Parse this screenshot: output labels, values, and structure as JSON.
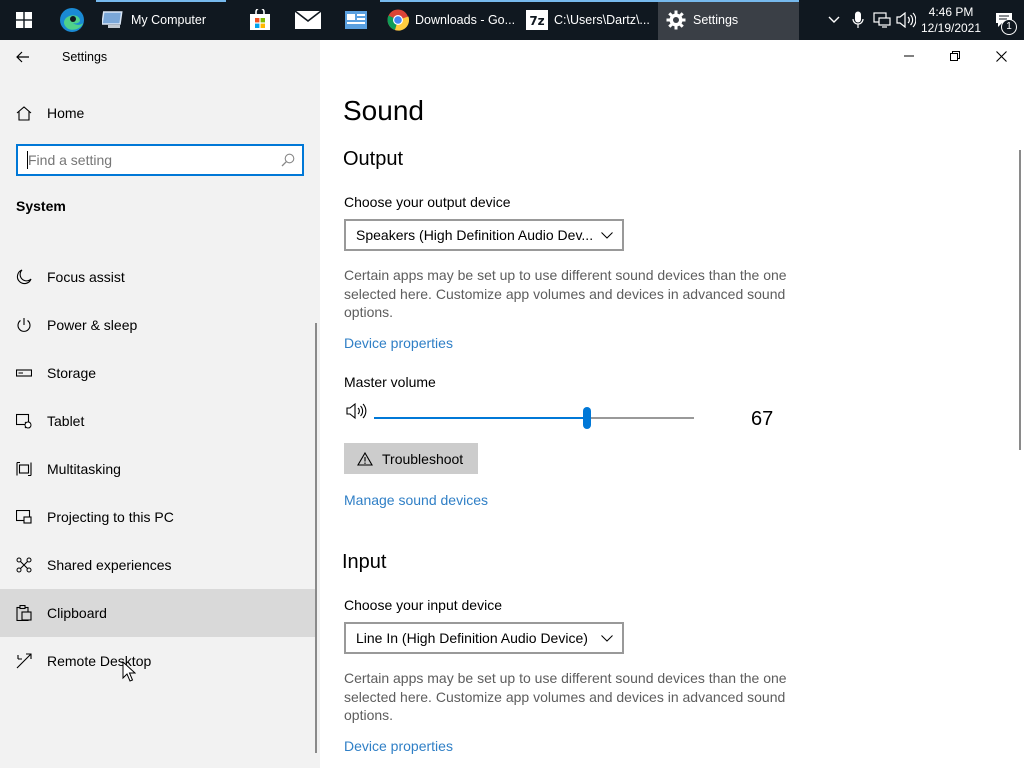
{
  "taskbar": {
    "apps": [
      {
        "label": "My Computer",
        "icon": "computer-icon"
      },
      {
        "label": "Downloads - Go...",
        "icon": "chrome-icon"
      },
      {
        "label": "C:\\Users\\Dartz\\...",
        "icon": "7zip-icon",
        "icon_text": "7z"
      },
      {
        "label": "Settings",
        "icon": "gear-icon"
      }
    ],
    "pinned": [
      "start-icon",
      "edge-icon",
      "store-icon",
      "mail-icon",
      "news-icon"
    ],
    "clock": {
      "time": "4:46 PM",
      "date": "12/19/2021"
    },
    "notification_count": "1",
    "accent_color": "#76b9ed"
  },
  "sidebar": {
    "window_title": "Settings",
    "home_label": "Home",
    "search_placeholder": "Find a setting",
    "section": "System",
    "items": [
      {
        "label": "Focus assist",
        "icon": "moon-icon"
      },
      {
        "label": "Power & sleep",
        "icon": "power-icon"
      },
      {
        "label": "Storage",
        "icon": "storage-icon"
      },
      {
        "label": "Tablet",
        "icon": "tablet-icon"
      },
      {
        "label": "Multitasking",
        "icon": "multitasking-icon"
      },
      {
        "label": "Projecting to this PC",
        "icon": "projecting-icon"
      },
      {
        "label": "Shared experiences",
        "icon": "shared-experiences-icon"
      },
      {
        "label": "Clipboard",
        "icon": "clipboard-icon"
      },
      {
        "label": "Remote Desktop",
        "icon": "remote-desktop-icon"
      }
    ]
  },
  "main": {
    "title": "Sound",
    "output": {
      "heading": "Output",
      "device_label": "Choose your output device",
      "device_value": "Speakers (High Definition Audio Dev...",
      "description": "Certain apps may be set up to use different sound devices than the one selected here. Customize app volumes and devices in advanced sound options.",
      "device_properties": "Device properties",
      "master_volume_label": "Master volume",
      "volume": 67,
      "volume_text": "67",
      "troubleshoot": "Troubleshoot",
      "manage_devices": "Manage sound devices"
    },
    "input": {
      "heading": "Input",
      "device_label": "Choose your input device",
      "device_value": "Line In (High Definition Audio Device)",
      "description": "Certain apps may be set up to use different sound devices than the one selected here. Customize app volumes and devices in advanced sound options.",
      "device_properties": "Device properties"
    },
    "accent_color": "#0078d7",
    "link_color": "#2f7fc6"
  }
}
